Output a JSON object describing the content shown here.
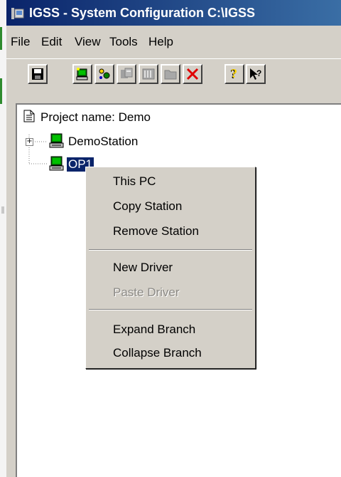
{
  "window": {
    "title": "IGSS -  System Configuration C:\\IGSS"
  },
  "menu": [
    "File",
    "Edit",
    "View",
    "Tools",
    "Help"
  ],
  "toolbar": {
    "buttons": [
      {
        "icon": "save-icon"
      },
      {
        "icon": "new-station-icon"
      },
      {
        "icon": "new-driver-icon"
      },
      {
        "icon": "copy-icon"
      },
      {
        "icon": "module-icon"
      },
      {
        "icon": "folder-icon"
      },
      {
        "icon": "delete-icon"
      },
      {
        "icon": "help-icon"
      },
      {
        "icon": "context-help-icon"
      }
    ],
    "delete_color": "#e00000"
  },
  "tree": {
    "project_label": "Project name: Demo",
    "nodes": [
      {
        "label": "DemoStation",
        "expander": "+"
      },
      {
        "label": "OP1",
        "selected": true
      }
    ]
  },
  "context_menu": {
    "groups": [
      [
        {
          "label": "This PC"
        },
        {
          "label": "Copy Station"
        },
        {
          "label": "Remove Station"
        }
      ],
      [
        {
          "label": "New Driver"
        },
        {
          "label": "Paste Driver",
          "disabled": true
        }
      ],
      [
        {
          "label": "Expand Branch"
        },
        {
          "label": "Collapse Branch"
        }
      ]
    ]
  },
  "colors": {
    "titlebar_start": "#0a246a",
    "titlebar_end": "#3a6ea5",
    "selection": "#0a246a",
    "face": "#d4d0c8"
  }
}
